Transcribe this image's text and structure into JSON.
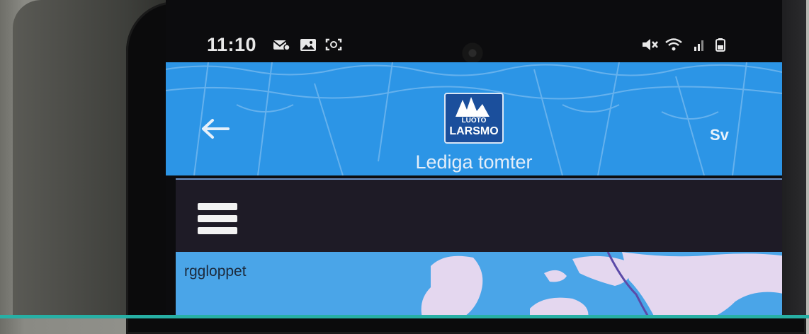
{
  "status_bar": {
    "time": "11:10",
    "left_icons": [
      "email-notification-icon",
      "image-notification-icon",
      "screenshot-icon"
    ],
    "right_icons": [
      "mute-icon",
      "wifi-icon",
      "signal-icon",
      "battery-icon"
    ]
  },
  "header": {
    "logo": {
      "line1": "LUOTO",
      "line2": "LARSMO"
    },
    "language": "Sv",
    "title": "Lediga tomter",
    "back_icon": "arrow-left-icon",
    "color": "#2c95e6"
  },
  "toolbar": {
    "menu_icon": "hamburger-menu-icon",
    "color": "#1e1b26"
  },
  "map": {
    "place_label": "rggloppet",
    "water_color": "#4aa5e8",
    "land_color": "#e4d7ef"
  }
}
